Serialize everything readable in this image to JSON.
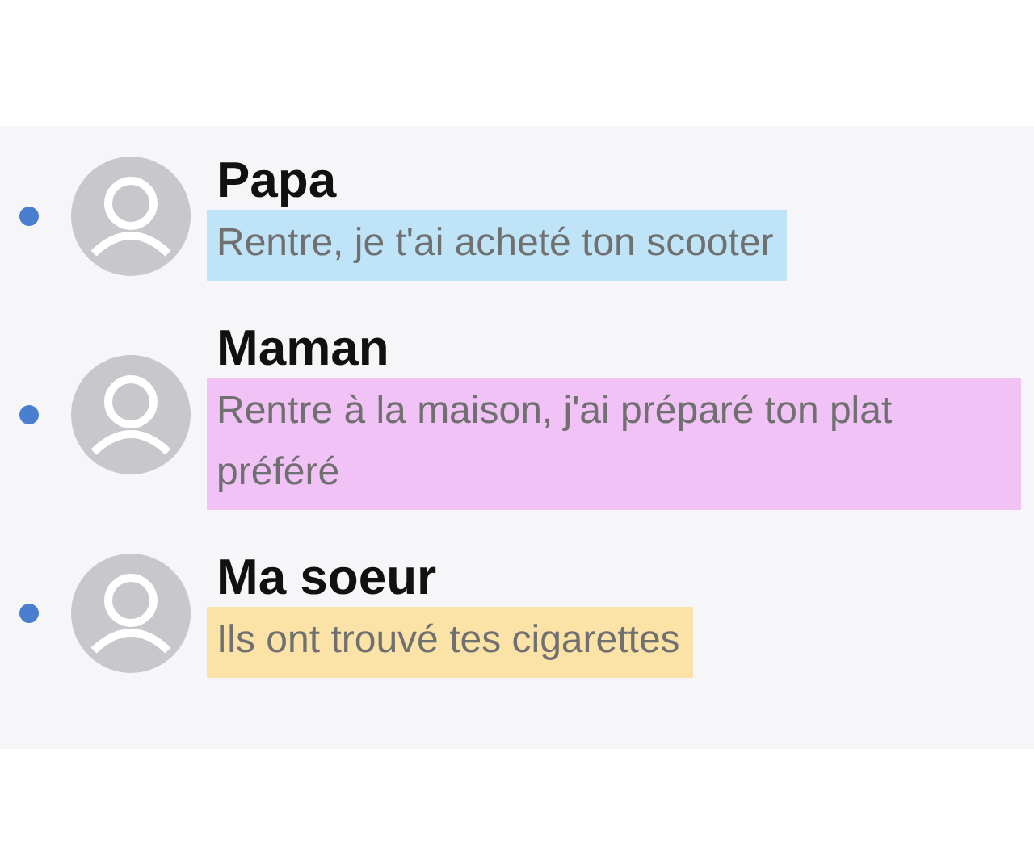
{
  "conversations": [
    {
      "name": "Papa",
      "message": "Rentre, je t'ai acheté ton scooter",
      "unread": true,
      "color": "#bfe3f7"
    },
    {
      "name": "Maman",
      "message": "Rentre à la maison, j'ai préparé ton plat préféré",
      "unread": true,
      "color": "#f0c2f5"
    },
    {
      "name": "Ma soeur",
      "message": "Ils ont trouvé tes cigarettes",
      "unread": true,
      "color": "#fbe3a8"
    }
  ]
}
